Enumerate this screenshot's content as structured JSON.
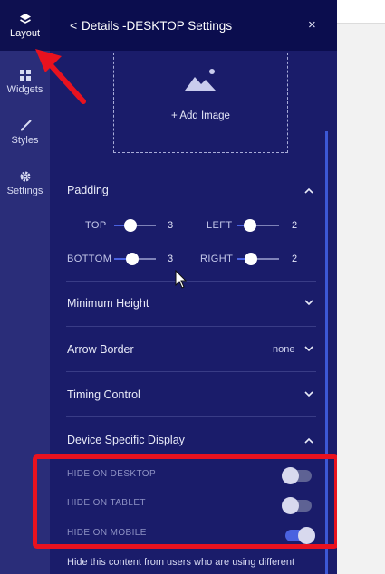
{
  "rail": {
    "items": [
      {
        "label": "Layout",
        "icon": "layers-icon"
      },
      {
        "label": "Widgets",
        "icon": "widgets-grid-icon"
      },
      {
        "label": "Styles",
        "icon": "brush-icon"
      },
      {
        "label": "Settings",
        "icon": "gear-icon"
      }
    ]
  },
  "header": {
    "back_glyph": "<",
    "title": "Details -DESKTOP Settings",
    "close_glyph": "×"
  },
  "image_box": {
    "add_label": "+ Add Image"
  },
  "padding": {
    "title": "Padding",
    "top_label": "TOP",
    "top_value": "3",
    "left_label": "LEFT",
    "left_value": "2",
    "bottom_label": "BOTTOM",
    "bottom_value": "3",
    "right_label": "RIGHT",
    "right_value": "2"
  },
  "sections": {
    "min_height": "Minimum Height",
    "arrow_border": "Arrow Border",
    "arrow_border_value": "none",
    "timing_control": "Timing Control",
    "device_display": "Device Specific Display"
  },
  "device": {
    "hide_desktop": "HIDE ON DESKTOP",
    "hide_tablet": "HIDE ON TABLET",
    "hide_mobile": "HIDE ON MOBILE",
    "hide_desktop_on": false,
    "hide_tablet_on": false,
    "hide_mobile_on": true
  },
  "hint": "Hide this content from users who are using different",
  "colors": {
    "accent": "#4a62e0",
    "highlight": "#e8121f",
    "panel": "#1a1c6a",
    "header": "#0b0d4e"
  }
}
